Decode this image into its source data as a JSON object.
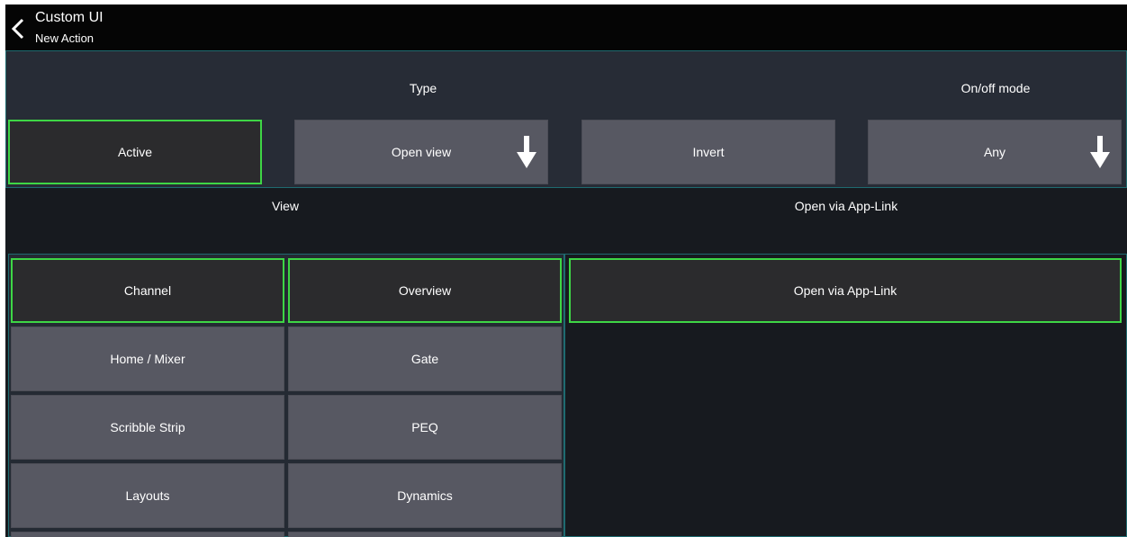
{
  "header": {
    "title": "Custom UI",
    "subtitle": "New Action"
  },
  "top": {
    "type_label": "Type",
    "onoff_label": "On/off mode",
    "active_button": "Active",
    "type_value": "Open view",
    "invert_button": "Invert",
    "onoff_value": "Any"
  },
  "section": {
    "view_label": "View",
    "applink_label": "Open via App-Link"
  },
  "views": {
    "col1": [
      "Channel",
      "Home / Mixer",
      "Scribble Strip",
      "Layouts"
    ],
    "col2": [
      "Overview",
      "Gate",
      "PEQ",
      "Dynamics"
    ]
  },
  "applink": {
    "option": "Open via App-Link"
  },
  "colors": {
    "accent": "#3ed645",
    "panel": "#272c36",
    "button": "#575862",
    "frame": "#1f6b70"
  }
}
